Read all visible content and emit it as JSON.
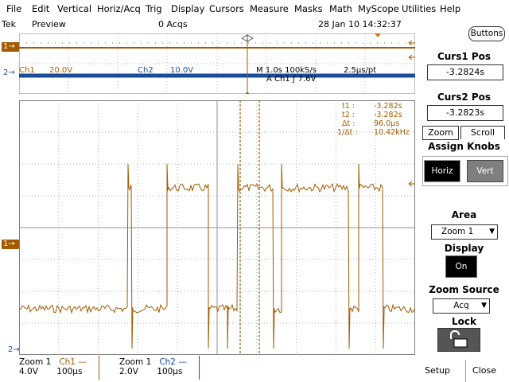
{
  "menu": {
    "file": "File",
    "edit": "Edit",
    "vertical": "Vertical",
    "horiz": "Horiz/Acq",
    "trig": "Trig",
    "display": "Display",
    "cursors": "Cursors",
    "measure": "Measure",
    "masks": "Masks",
    "math": "Math",
    "myscope": "MyScope",
    "utilities": "Utilities",
    "help": "Help"
  },
  "status": {
    "brand": "Tek",
    "mode": "Preview",
    "acqs": "0 Acqs",
    "datetime": "28 Jan 10 14:32:37",
    "buttons_label": "Buttons"
  },
  "overview": {
    "ch1_label": "Ch1",
    "ch1_scale": "20.0V",
    "ch2_label": "Ch2",
    "ch2_scale": "10.0V",
    "timebase": "M 1.0s 100kS/s",
    "sample": "2.5μs/pt",
    "trigger": "A  Ch1  ƒ  7.6V"
  },
  "markers": {
    "ch1": "1",
    "ch2": "2",
    "ch1_main": "1",
    "ch2_main": "2"
  },
  "cursor_readout": {
    "t1_label": "t1 :",
    "t1_value": "-3.282s",
    "t2_label": "t2 :",
    "t2_value": "-3.282s",
    "dt_label": "Δt :",
    "dt_value": "96.0μs",
    "inv_label": "1/Δt :",
    "inv_value": "10.42kHz"
  },
  "bottom": {
    "z1_title": "Zoom 1",
    "z1_ch": "Ch1 —",
    "z1_volts": "4.0V",
    "z1_time": "100μs",
    "z2_title": "Zoom 1",
    "z2_ch": "Ch2 —",
    "z2_volts": "2.0V",
    "z2_time": "100μs"
  },
  "panel": {
    "curs1_title": "Curs1 Pos",
    "curs1_value": "-3.2824s",
    "curs2_title": "Curs2 Pos",
    "curs2_value": "-3.2823s",
    "tab_zoom": "Zoom",
    "tab_scroll": "Scroll",
    "assign_knobs": "Assign Knobs",
    "horiz_btn": "Horiz",
    "vert_btn": "Vert",
    "area_title": "Area",
    "area_value": "Zoom 1",
    "display_title": "Display",
    "display_value": "On",
    "zoom_source_title": "Zoom Source",
    "zoom_source_value": "Acq",
    "lock_title": "Lock",
    "setup_btn": "Setup",
    "close_btn": "Close"
  },
  "colors": {
    "ch1": "#a35a00",
    "ch2": "#1a4d99",
    "grid": "#b0b0b0",
    "knob_active": "#000000",
    "knob_inactive": "#7f7f7f"
  },
  "icons": {
    "lock": "padlock-open-icon",
    "trigger": "trigger-arrow-icon",
    "cursor_diamond": "cursor-region-icon"
  }
}
